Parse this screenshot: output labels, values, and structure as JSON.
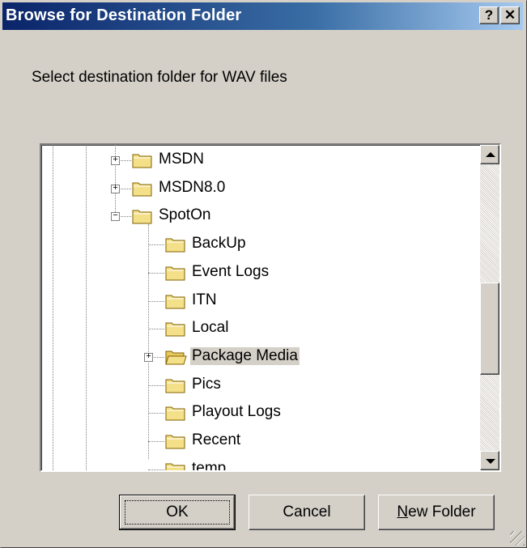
{
  "window": {
    "title": "Browse for Destination Folder",
    "help_label": "?",
    "close_label": "✕"
  },
  "prompt": "Select destination folder for WAV files",
  "tree": {
    "items": [
      {
        "label": "MSDN",
        "level": 1,
        "expander": "+"
      },
      {
        "label": "MSDN8.0",
        "level": 1,
        "expander": "+"
      },
      {
        "label": "SpotOn",
        "level": 1,
        "expander": "−",
        "open": true
      },
      {
        "label": "BackUp",
        "level": 2,
        "expander": ""
      },
      {
        "label": "Event Logs",
        "level": 2,
        "expander": ""
      },
      {
        "label": "ITN",
        "level": 2,
        "expander": ""
      },
      {
        "label": "Local",
        "level": 2,
        "expander": ""
      },
      {
        "label": "Package Media",
        "level": 2,
        "expander": "+",
        "selected": true,
        "open_folder": true
      },
      {
        "label": "Pics",
        "level": 2,
        "expander": ""
      },
      {
        "label": "Playout Logs",
        "level": 2,
        "expander": ""
      },
      {
        "label": "Recent",
        "level": 2,
        "expander": ""
      },
      {
        "label": "temp",
        "level": 2,
        "expander": ""
      }
    ]
  },
  "buttons": {
    "ok": "OK",
    "cancel": "Cancel",
    "new_folder_mnemonic": "N",
    "new_folder_rest": "ew Folder"
  },
  "colors": {
    "title_start": "#0a246a",
    "title_end": "#a6caf0",
    "dialog_bg": "#d4d0c8",
    "folder": "#f5e08a"
  },
  "scroll_position": 0.5
}
